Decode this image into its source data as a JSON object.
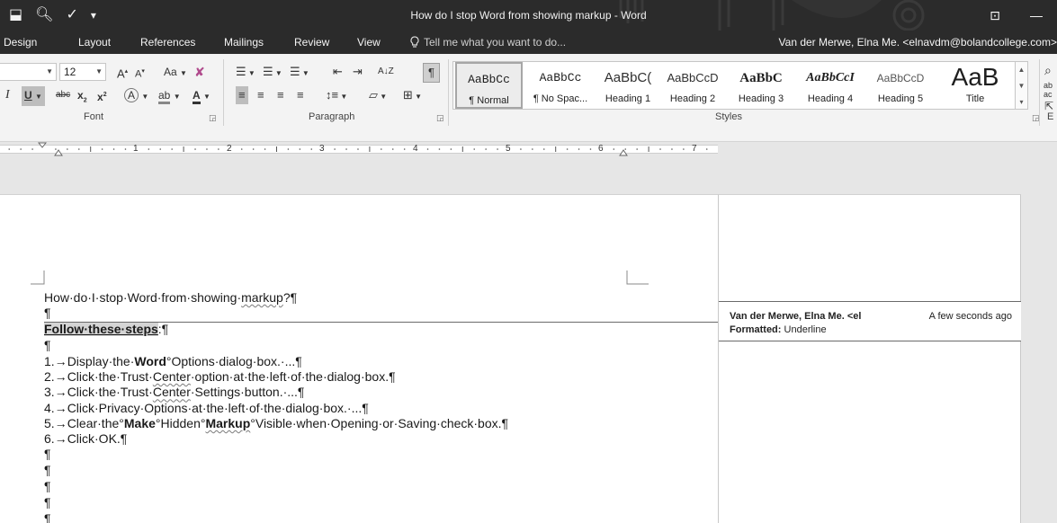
{
  "window": {
    "title": "How do I stop Word from showing markup - Word",
    "qat_icons": [
      "save-touch-icon",
      "print-preview-icon",
      "spelling-icon",
      "customize-qat-icon"
    ],
    "ribbon_display_glyph": "⊡",
    "minimize_glyph": "—"
  },
  "tabs": {
    "items": [
      {
        "label": "Design",
        "name": "tab-design"
      },
      {
        "label": "Layout",
        "name": "tab-layout"
      },
      {
        "label": "References",
        "name": "tab-references"
      },
      {
        "label": "Mailings",
        "name": "tab-mailings"
      },
      {
        "label": "Review",
        "name": "tab-review"
      },
      {
        "label": "View",
        "name": "tab-view"
      }
    ],
    "tell_me": "Tell me what you want to do...",
    "user": "Van der Merwe, Elna Me. <elnavdm@bolandcollege.com>"
  },
  "ribbon": {
    "font": {
      "size": "12",
      "grow": "A",
      "shrink": "A",
      "change_case": "Aa",
      "italic": "I",
      "underline": "U",
      "strikethrough": "abc",
      "subscript": "x",
      "superscript": "x",
      "text_effects": "A",
      "highlight": "ab",
      "font_color": "A",
      "label": "Font"
    },
    "paragraph": {
      "sort": "A↓Z",
      "show_marks": "¶",
      "label": "Paragraph"
    },
    "styles": {
      "items": [
        {
          "preview": "AaBbCc",
          "name": "¶ Normal",
          "selected": true
        },
        {
          "preview": "AaBbCc",
          "name": "¶ No Spac..."
        },
        {
          "preview": "AaBbC(",
          "name": "Heading 1"
        },
        {
          "preview": "AaBbCcD",
          "name": "Heading 2"
        },
        {
          "preview": "AaBbC",
          "name": "Heading 3"
        },
        {
          "preview": "AaBbCcI",
          "name": "Heading 4"
        },
        {
          "preview": "AaBbCcD",
          "name": "Heading 5"
        },
        {
          "preview": "AaB",
          "name": "Title"
        }
      ],
      "label": "Styles"
    },
    "editing": {
      "find_glyph": "⌕",
      "replace_glyph": "ab→ac",
      "select_glyph": "⇱",
      "label": "E"
    }
  },
  "ruler": {
    "numbers": [
      "1",
      "2",
      "3",
      "4",
      "5",
      "6",
      "7"
    ]
  },
  "document": {
    "title_line": {
      "before": "How·do·I·stop·Word·from·showing·",
      "squiggly": "markup",
      "after": "?¶"
    },
    "empty_mark": "¶",
    "steps_heading": {
      "text": "Follow·these·steps",
      "after": ":¶"
    },
    "steps": [
      {
        "num": "1.→",
        "parts": [
          {
            "t": "Display·the·"
          },
          {
            "t": "Word",
            "b": true
          },
          {
            "t": "°Options·dialog·box.·...¶"
          }
        ]
      },
      {
        "num": "2.→",
        "parts": [
          {
            "t": "Click·the·Trust·"
          },
          {
            "t": "Center",
            "sq": true
          },
          {
            "t": "·option·at·the·left·of·the·dialog·box.¶"
          }
        ]
      },
      {
        "num": "3.→",
        "parts": [
          {
            "t": "Click·the·Trust·"
          },
          {
            "t": "Center",
            "sq": true
          },
          {
            "t": "·Settings·button.·...¶"
          }
        ]
      },
      {
        "num": "4.→",
        "parts": [
          {
            "t": "Click·Privacy·Options·at·the·left·of·the·dialog·box.·...¶"
          }
        ]
      },
      {
        "num": "5.→",
        "parts": [
          {
            "t": "Clear·the°"
          },
          {
            "t": "Make",
            "b": true
          },
          {
            "t": "°Hidden°"
          },
          {
            "t": "Markup",
            "b": true,
            "sq": true
          },
          {
            "t": "°Visible·when·Opening·or·Saving·check·box.¶"
          }
        ]
      },
      {
        "num": "6.→",
        "parts": [
          {
            "t": "Click·OK.¶"
          }
        ]
      }
    ]
  },
  "comment": {
    "author": "Van der Merwe, Elna Me. <el",
    "time": "A few seconds ago",
    "kind": "Formatted:",
    "detail": "Underline"
  }
}
